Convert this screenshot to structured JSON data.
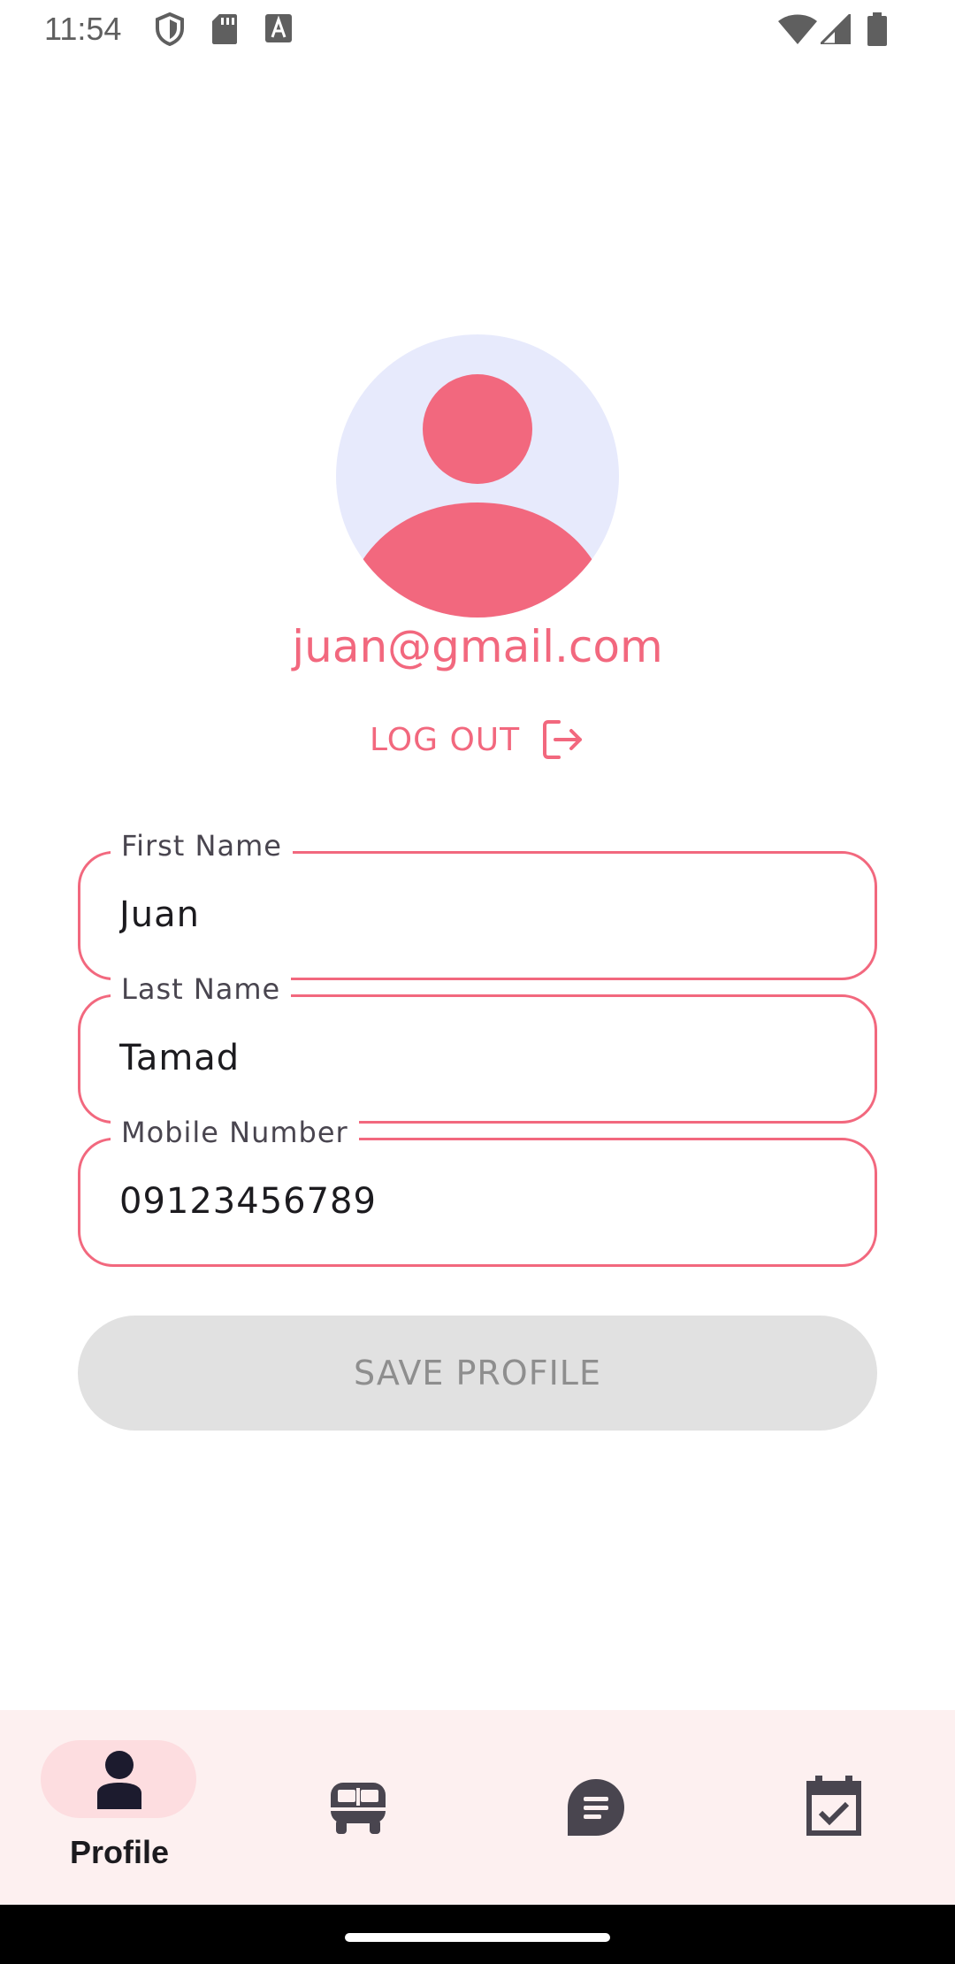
{
  "status_bar": {
    "time": "11:54",
    "left_icons": [
      "shield-icon",
      "sd-card-icon",
      "font-a-icon"
    ],
    "right_icons": [
      "wifi-icon",
      "signal-icon",
      "battery-icon"
    ]
  },
  "profile": {
    "avatar_icon": "person-avatar-icon",
    "email": "juan@gmail.com",
    "logout_label": "LOG OUT",
    "logout_icon": "logout-icon"
  },
  "form": {
    "first_name": {
      "label": "First Name",
      "value": "Juan"
    },
    "last_name": {
      "label": "Last Name",
      "value": "Tamad"
    },
    "mobile": {
      "label": "Mobile Number",
      "value": "09123456789"
    },
    "save_label": "SAVE PROFILE"
  },
  "bottom_nav": {
    "items": [
      {
        "label": "Profile",
        "icon": "person-icon",
        "selected": true
      },
      {
        "label": "",
        "icon": "bus-icon",
        "selected": false
      },
      {
        "label": "",
        "icon": "chat-icon",
        "selected": false
      },
      {
        "label": "",
        "icon": "calendar-check-icon",
        "selected": false
      }
    ]
  },
  "colors": {
    "accent": "#f2687e",
    "avatar_bg": "#e7eafc",
    "nav_bg": "#fdf0f0",
    "nav_pill": "#fddde0",
    "disabled_btn": "#e1e1e1"
  }
}
